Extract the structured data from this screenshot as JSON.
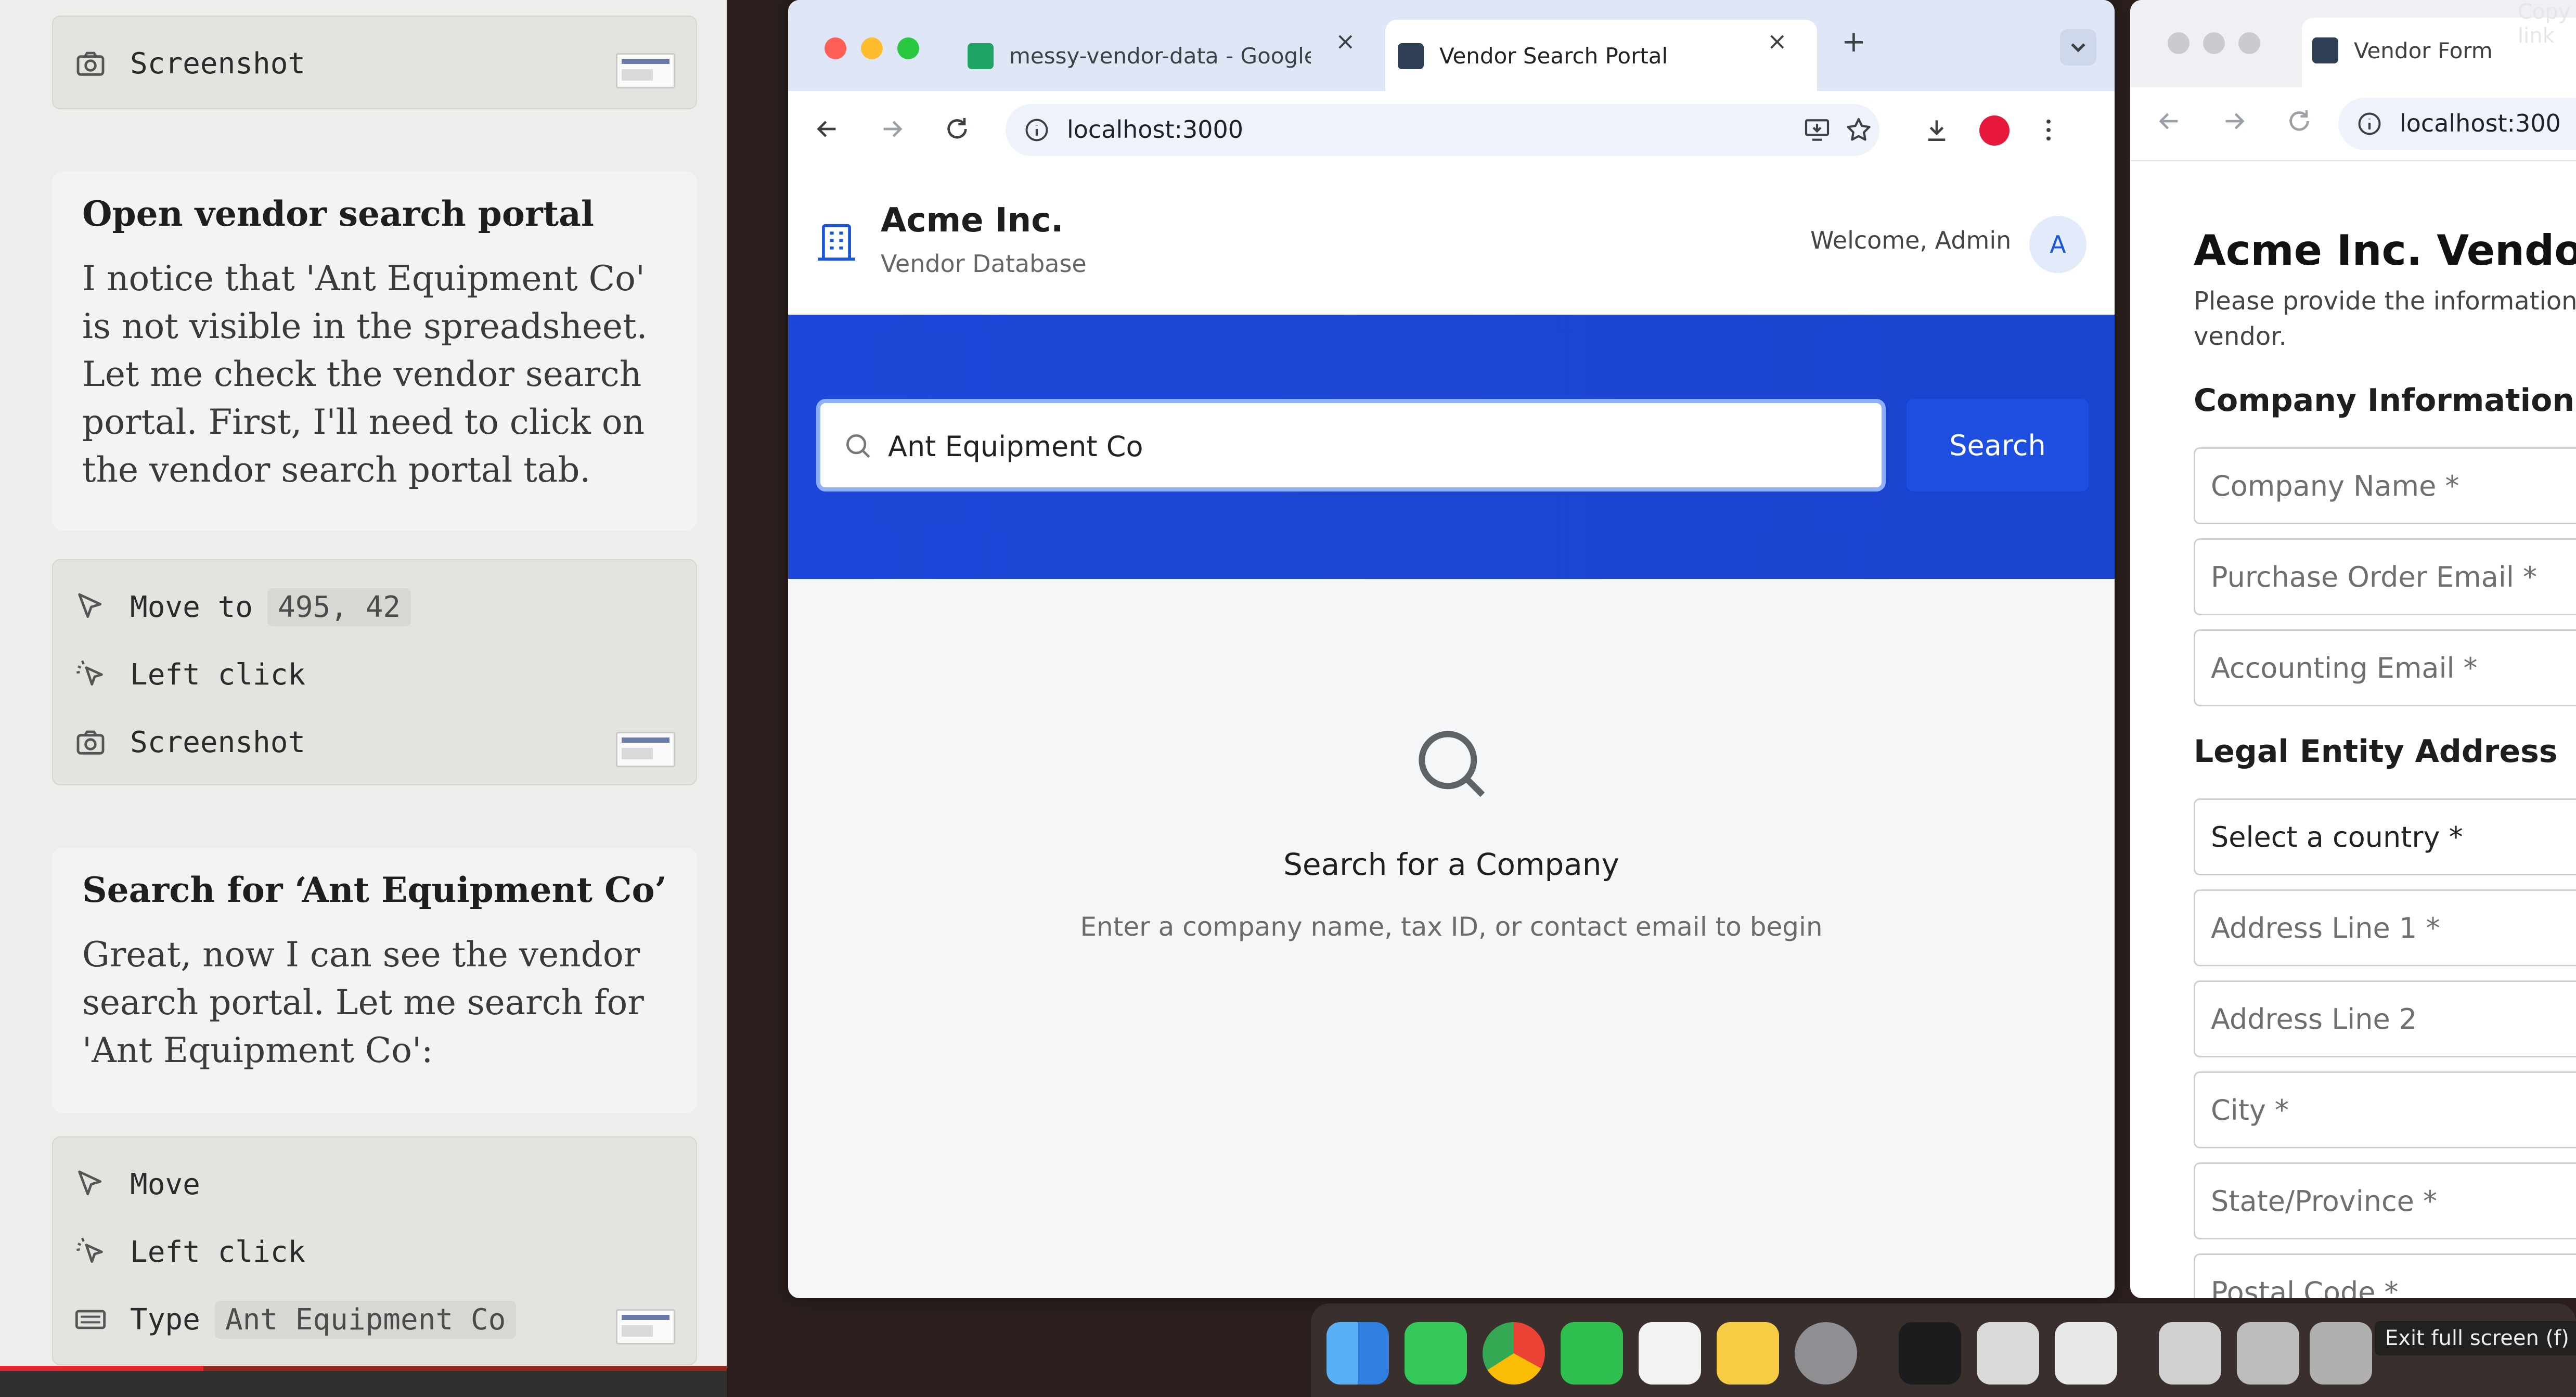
{
  "agent_log": {
    "top_step": {
      "action": "Screenshot"
    },
    "card1": {
      "heading": "Open vendor search portal",
      "body": "I notice that 'Ant Equipment Co' is not visible in the spreadsheet. Let me check the vendor search portal. First, I'll need to click on the vendor search portal tab."
    },
    "steps1": [
      {
        "action": "Move to",
        "arg": "495, 42"
      },
      {
        "action": "Left click"
      },
      {
        "action": "Screenshot"
      }
    ],
    "card2": {
      "heading": "Search for ‘Ant Equipment Co’",
      "body": "Great, now I can see the vendor search portal. Let me search for 'Ant Equipment Co':"
    },
    "steps2": [
      {
        "action": "Move"
      },
      {
        "action": "Left click"
      },
      {
        "action": "Type",
        "arg": "Ant Equipment Co"
      }
    ]
  },
  "video": {
    "progress": 0.28
  },
  "browser": {
    "tabs": [
      {
        "title": "messy-vendor-data - Google",
        "favicon": "sheets-icon",
        "active": false
      },
      {
        "title": "Vendor Search Portal",
        "favicon": "portal-icon",
        "active": true
      }
    ],
    "url": "localhost:3000",
    "profile_color": "#e8173c"
  },
  "app": {
    "brand": "Acme Inc.",
    "subtitle": "Vendor Database",
    "welcome": "Welcome, Admin",
    "avatar": "A",
    "search": {
      "value": "Ant Equipment Co",
      "button": "Search"
    },
    "empty_state": {
      "title": "Search for a Company",
      "subtitle": "Enter a company name, tax ID, or contact email to begin"
    },
    "colors": {
      "hero": "#1d47d8",
      "button": "#1f4fe0"
    }
  },
  "browser2": {
    "tab_title": "Vendor Form",
    "url": "localhost:300",
    "form": {
      "title": "Acme Inc. Vendor R",
      "description": "Please provide the information be vendor.",
      "section_company": "Company Information",
      "company_fields": [
        "Company Name *",
        "Purchase Order Email *",
        "Accounting Email *"
      ],
      "section_address": "Legal Entity Address",
      "address_fields": [
        "Select a country *",
        "Address Line 1 *",
        "Address Line 2",
        "City *",
        "State/Province *",
        "Postal Code *"
      ]
    }
  },
  "overlay": {
    "tooltip": "Exit full screen (f)",
    "copy_link": "Copy link"
  }
}
